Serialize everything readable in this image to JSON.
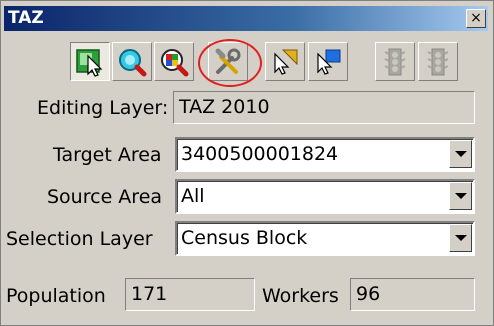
{
  "window": {
    "title": "TAZ",
    "close_glyph": "×"
  },
  "toolbar": {
    "buttons": [
      {
        "icon": "select-pointer-icon",
        "state": "pressed"
      },
      {
        "icon": "zoom-icon",
        "state": "normal"
      },
      {
        "icon": "identify-zoom-icon",
        "state": "normal"
      },
      {
        "icon": "tools-settings-icon",
        "state": "normal",
        "highlighted": true,
        "highlight_color": "#e02020"
      },
      {
        "icon": "pointer-arrow-icon",
        "state": "normal"
      },
      {
        "icon": "pointer-flag-icon",
        "state": "normal"
      },
      {
        "icon": "traffic-light-icon",
        "state": "disabled"
      },
      {
        "icon": "traffic-light-icon",
        "state": "disabled"
      }
    ]
  },
  "form": {
    "editing_layer": {
      "label": "Editing Layer:",
      "value": "TAZ 2010"
    },
    "target_area": {
      "label": "Target Area",
      "value": "3400500001824"
    },
    "source_area": {
      "label": "Source Area",
      "value": "All"
    },
    "selection_layer": {
      "label": "Selection Layer",
      "value": "Census Block"
    }
  },
  "stats": {
    "population": {
      "label": "Population",
      "value": "171"
    },
    "workers": {
      "label": "Workers",
      "value": "96"
    }
  },
  "colors": {
    "titlebar_start": "#0a246a",
    "titlebar_end": "#a6caf0",
    "panel": "#d4d0c8",
    "highlight_ring": "#e02020"
  }
}
